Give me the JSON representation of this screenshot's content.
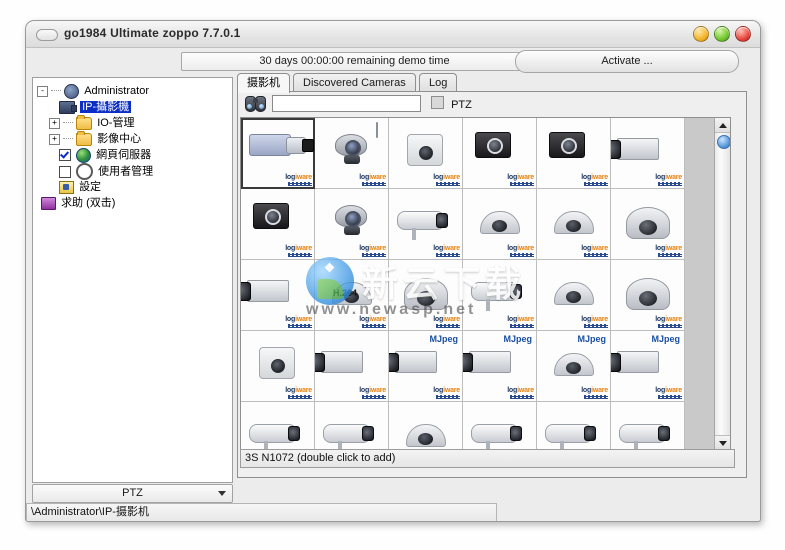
{
  "window": {
    "title": "go1984 Ultimate zoppo 7.7.0.1",
    "demo_bar_text": "30 days 00:00:00 remaining demo time",
    "activate_button": "Activate ...",
    "buttons": {
      "minimize": "minimize-button",
      "maximize": "maximize-button",
      "close": "close-button"
    }
  },
  "tree": {
    "items": [
      {
        "label": "Administrator",
        "icon": "user-icon",
        "expander": "-",
        "indent": 0,
        "selected": false,
        "checkbox": null
      },
      {
        "label": "IP-攝影機",
        "icon": "camera-icon",
        "expander": "",
        "indent": 1,
        "selected": true,
        "checkbox": null
      },
      {
        "label": "IO-管理",
        "icon": "folder-icon",
        "expander": "+",
        "indent": 1,
        "selected": false,
        "checkbox": null
      },
      {
        "label": "影像中心",
        "icon": "folder-icon",
        "expander": "+",
        "indent": 1,
        "selected": false,
        "checkbox": null
      },
      {
        "label": "網頁伺服器",
        "icon": "globe-icon",
        "expander": "",
        "indent": 1,
        "selected": false,
        "checkbox": "checked"
      },
      {
        "label": "使用者管理",
        "icon": "key-icon",
        "expander": "",
        "indent": 1,
        "selected": false,
        "checkbox": "unchecked"
      },
      {
        "label": "設定",
        "icon": "gear-icon",
        "expander": "",
        "indent": 1,
        "selected": false,
        "checkbox": null
      },
      {
        "label": "求助 (双击)",
        "icon": "book-icon",
        "expander": "",
        "indent": 0,
        "selected": false,
        "checkbox": null
      }
    ]
  },
  "ptz_select": {
    "value": "PTZ"
  },
  "status_path": "\\Administrator\\IP-摄影机",
  "tabs": [
    {
      "label": "摄影机",
      "active": true
    },
    {
      "label": "Discovered Cameras",
      "active": false
    },
    {
      "label": "Log",
      "active": false
    }
  ],
  "toolbar": {
    "search_icon": "binoculars-icon",
    "search_value": "",
    "search_placeholder": "",
    "ptz_checkbox_label": "PTZ",
    "ptz_checked": false
  },
  "grid_status": "3S N1072 (double click to add)",
  "watermark": {
    "brand": "logiware",
    "site_text": "新云下载",
    "site_url": "www.newasp.net"
  },
  "camera_grid": {
    "columns": 6,
    "selected_index": 0,
    "cells": [
      {
        "shape": "box-cam",
        "badge": "",
        "watermark": true
      },
      {
        "shape": "webcam",
        "badge": "",
        "watermark": true,
        "antenna": true
      },
      {
        "shape": "mini",
        "badge": "",
        "watermark": true
      },
      {
        "shape": "dark-box",
        "badge": "",
        "watermark": true
      },
      {
        "shape": "dark-box",
        "badge": "",
        "watermark": true
      },
      {
        "shape": "lenscam",
        "badge": "",
        "watermark": true
      },
      {
        "shape": "dark-box",
        "badge": "",
        "watermark": true
      },
      {
        "shape": "webcam",
        "badge": "",
        "watermark": true
      },
      {
        "shape": "bullet",
        "badge": "",
        "watermark": true
      },
      {
        "shape": "dome",
        "badge": "",
        "watermark": true
      },
      {
        "shape": "dome",
        "badge": "",
        "watermark": true
      },
      {
        "shape": "ptzdome",
        "badge": "",
        "watermark": true
      },
      {
        "shape": "lenscam",
        "badge": "",
        "watermark": true
      },
      {
        "shape": "dome",
        "badge": "H.264",
        "watermark": true
      },
      {
        "shape": "ptzdome",
        "badge": "",
        "watermark": true
      },
      {
        "shape": "bullet",
        "badge": "",
        "watermark": true
      },
      {
        "shape": "dome",
        "badge": "",
        "watermark": true
      },
      {
        "shape": "ptzdome",
        "badge": "",
        "watermark": true
      },
      {
        "shape": "mini",
        "badge": "",
        "watermark": true
      },
      {
        "shape": "lenscam",
        "badge": "",
        "watermark": true
      },
      {
        "shape": "lenscam",
        "badge": "MJpeg",
        "watermark": true
      },
      {
        "shape": "lenscam",
        "badge": "MJpeg",
        "watermark": true
      },
      {
        "shape": "dome",
        "badge": "MJpeg",
        "watermark": true
      },
      {
        "shape": "lenscam",
        "badge": "MJpeg",
        "watermark": true
      },
      {
        "shape": "bullet",
        "badge": "",
        "watermark": false
      },
      {
        "shape": "bullet",
        "badge": "",
        "watermark": false
      },
      {
        "shape": "dome",
        "badge": "",
        "watermark": false
      },
      {
        "shape": "bullet",
        "badge": "",
        "watermark": false
      },
      {
        "shape": "bullet",
        "badge": "",
        "watermark": false
      },
      {
        "shape": "bullet",
        "badge": "",
        "watermark": false
      }
    ]
  },
  "colors": {
    "selection_blue": "#0a2ec6",
    "window_chrome": "#ececec",
    "logiware_orange": "#e8820e",
    "logiware_navy": "#19345e",
    "mjpeg_blue": "#1b4fa0"
  }
}
